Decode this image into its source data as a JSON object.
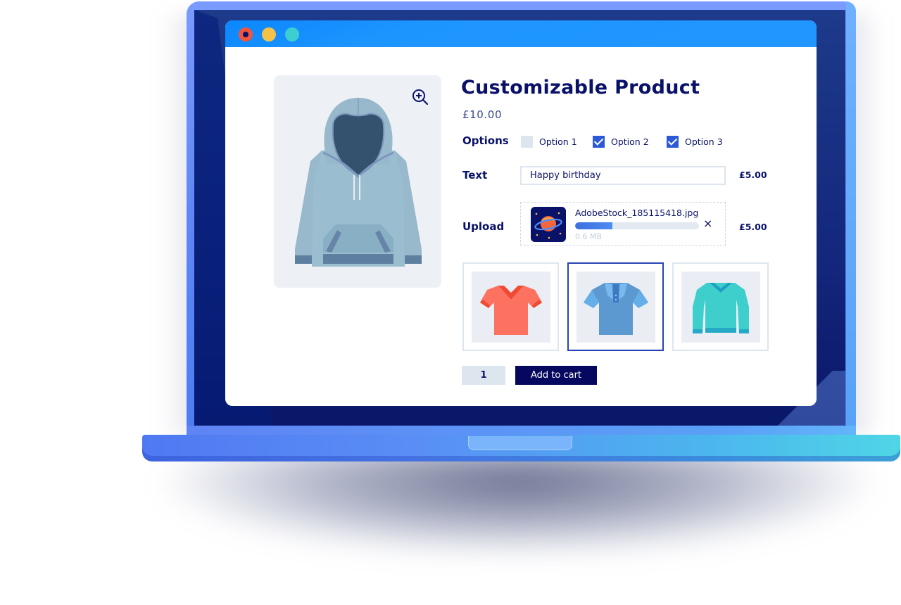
{
  "window": {
    "controls": [
      "close",
      "minimize",
      "maximize"
    ]
  },
  "product": {
    "title": "Customizable Product",
    "price": "£10.00",
    "zoom_icon": "zoom-in-icon",
    "image": "hoodie"
  },
  "options": {
    "label": "Options",
    "items": [
      {
        "label": "Option 1",
        "checked": false
      },
      {
        "label": "Option 2",
        "checked": true
      },
      {
        "label": "Option 3",
        "checked": true
      }
    ]
  },
  "text_field": {
    "label": "Text",
    "value": "Happy birthday",
    "surcharge": "£5.00"
  },
  "upload": {
    "label": "Upload",
    "filename": "AdobeStock_185115418.jpg",
    "filesize": "0.6 MB",
    "progress_percent": 30,
    "remove_icon": "×",
    "surcharge": "£5.00"
  },
  "variants": [
    {
      "name": "Orange V-neck T-shirt",
      "selected": false
    },
    {
      "name": "Blue polo shirt",
      "selected": true
    },
    {
      "name": "Teal sweater",
      "selected": false
    }
  ],
  "cart": {
    "quantity": "1",
    "add_label": "Add to cart"
  },
  "colors": {
    "navy": "#0a1168",
    "accent_blue": "#2196ff",
    "checkbox_blue": "#2c5ad6",
    "button_navy": "#05085e"
  }
}
